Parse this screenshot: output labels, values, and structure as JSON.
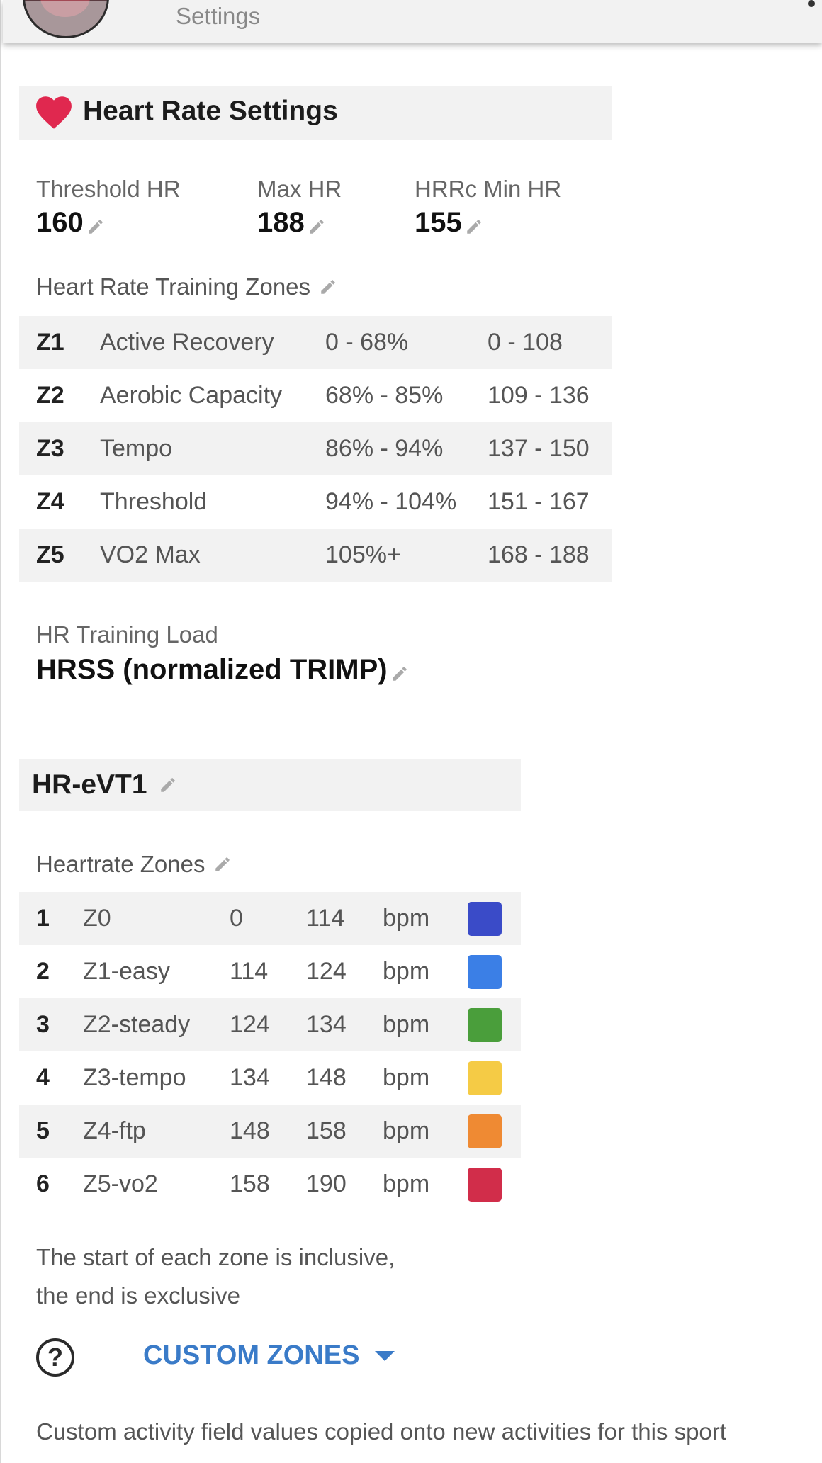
{
  "topbar": {
    "subtitle": "Settings"
  },
  "heart_rate": {
    "title": "Heart Rate Settings",
    "stats": [
      {
        "label": "Threshold HR",
        "value": "160"
      },
      {
        "label": "Max HR",
        "value": "188"
      },
      {
        "label": "HRRc Min HR",
        "value": "155"
      }
    ],
    "zones_label": "Heart Rate Training Zones",
    "zones": [
      {
        "code": "Z1",
        "name": "Active Recovery",
        "pct": "0 - 68%",
        "bpm": "0 - 108"
      },
      {
        "code": "Z2",
        "name": "Aerobic Capacity",
        "pct": "68% - 85%",
        "bpm": "109 - 136"
      },
      {
        "code": "Z3",
        "name": "Tempo",
        "pct": "86% - 94%",
        "bpm": "137 - 150"
      },
      {
        "code": "Z4",
        "name": "Threshold",
        "pct": "94% - 104%",
        "bpm": "151 - 167"
      },
      {
        "code": "Z5",
        "name": "VO2 Max",
        "pct": "105%+",
        "bpm": "168 - 188"
      }
    ],
    "load_label": "HR Training Load",
    "load_value": "HRSS (normalized TRIMP)"
  },
  "evt": {
    "title": "HR-eVT1",
    "zones_label": "Heartrate Zones",
    "zones": [
      {
        "idx": "1",
        "name": "Z0",
        "from": "0",
        "to": "114",
        "unit": "bpm",
        "color": "#3a4bc8"
      },
      {
        "idx": "2",
        "name": "Z1-easy",
        "from": "114",
        "to": "124",
        "unit": "bpm",
        "color": "#3b7fe6"
      },
      {
        "idx": "3",
        "name": "Z2-steady",
        "from": "124",
        "to": "134",
        "unit": "bpm",
        "color": "#4a9e3b"
      },
      {
        "idx": "4",
        "name": "Z3-tempo",
        "from": "134",
        "to": "148",
        "unit": "bpm",
        "color": "#f5cb45"
      },
      {
        "idx": "5",
        "name": "Z4-ftp",
        "from": "148",
        "to": "158",
        "unit": "bpm",
        "color": "#ef8a33"
      },
      {
        "idx": "6",
        "name": "Z5-vo2",
        "from": "158",
        "to": "190",
        "unit": "bpm",
        "color": "#d12d4a"
      }
    ],
    "note_line1": "The start of each zone is inclusive,",
    "note_line2": "the end is exclusive"
  },
  "custom_zones_label": "CUSTOM ZONES",
  "help_glyph": "?",
  "footer_text": "Custom activity field values copied onto new activities for this sport",
  "icons": {
    "heart": "heart-icon",
    "edit": "pencil-icon",
    "help": "help-circle-icon",
    "dropdown": "caret-down-icon"
  },
  "colors": {
    "accent": "#3a7bc8",
    "heart": "#e0284f"
  }
}
